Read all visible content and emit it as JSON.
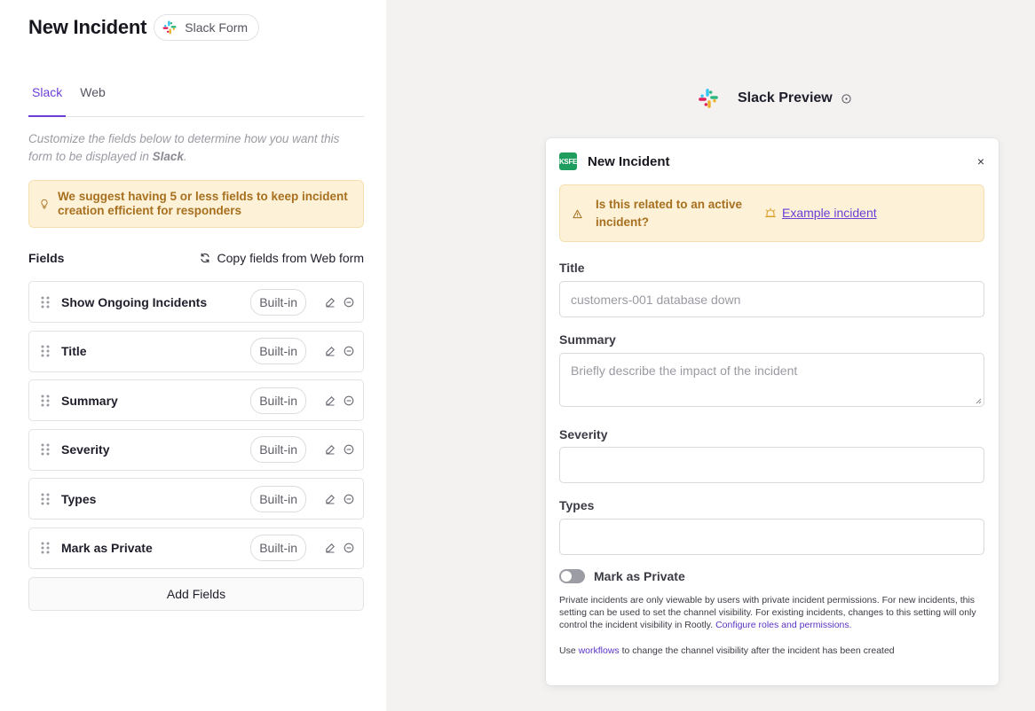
{
  "left": {
    "title": "New Incident",
    "form_pill": "Slack Form",
    "tabs": [
      {
        "label": "Slack",
        "active": true
      },
      {
        "label": "Web",
        "active": false
      }
    ],
    "hint_prefix": "Customize the fields below to determine how you want this form to be displayed in ",
    "hint_strong": "Slack",
    "hint_suffix": ".",
    "suggestion": "We suggest having 5 or less fields to keep incident creation efficient for responders",
    "fields_label": "Fields",
    "copy_label": "Copy fields from Web form",
    "fields": [
      {
        "name": "Show Ongoing Incidents",
        "badge": "Built-in"
      },
      {
        "name": "Title",
        "badge": "Built-in"
      },
      {
        "name": "Summary",
        "badge": "Built-in"
      },
      {
        "name": "Severity",
        "badge": "Built-in"
      },
      {
        "name": "Types",
        "badge": "Built-in"
      },
      {
        "name": "Mark as Private",
        "badge": "Built-in"
      }
    ],
    "add_label": "Add Fields"
  },
  "preview": {
    "title": "Slack Preview",
    "modal": {
      "app_icon_text": "KSFE",
      "title": "New Incident",
      "close": "×",
      "alert_question": "Is this related to an active incident?",
      "alert_link": "Example incident",
      "title_label": "Title",
      "title_placeholder": "customers-001 database down",
      "summary_label": "Summary",
      "summary_placeholder": "Briefly describe the impact of the incident",
      "severity_label": "Severity",
      "types_label": "Types",
      "private_label": "Mark as Private",
      "private_on": false,
      "note_text": "Private incidents are only viewable by users with private incident permissions. For new incidents, this setting can be used to set the channel visibility. For existing incidents, changes to this setting will only control the incident visibility in Rootly. ",
      "note_link": "Configure roles and permissions.",
      "workflow_prefix": "Use ",
      "workflow_link": "workflows",
      "workflow_suffix": " to change the channel visibility after the incident has been created"
    }
  },
  "colors": {
    "accent": "#6b3fd6",
    "warning_bg": "#fdf1d8",
    "warning_text": "#a7701f",
    "preview_bg": "#f3f2f1"
  }
}
